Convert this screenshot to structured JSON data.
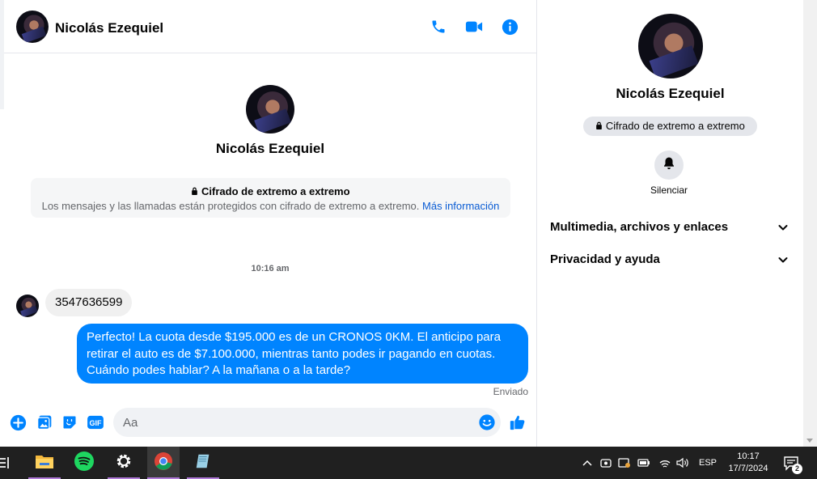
{
  "conversation": {
    "contact_name": "Nicolás Ezequiel"
  },
  "encryption": {
    "title": "Cifrado de extremo a extremo",
    "description": "Los mensajes y las llamadas están protegidos con cifrado de extremo a extremo.",
    "link": "Más información"
  },
  "messages": {
    "timestamp": "10:16 am",
    "incoming_text": "3547636599",
    "outgoing_text": "Perfecto! La cuota desde $195.000 es de un CRONOS 0KM. El anticipo para retirar el auto es de $7.100.000, mientras tanto podes ir pagando en cuotas. Cuándo podes hablar? A la mañana o a la tarde?",
    "status": "Enviado"
  },
  "composer": {
    "placeholder": "Aa",
    "icons": [
      "plus-icon",
      "photo-icon",
      "sticker-icon",
      "gif-icon",
      "emoji-icon",
      "thumbs-up-icon"
    ]
  },
  "info_panel": {
    "name": "Nicolás Ezequiel",
    "badge": "Cifrado de extremo a extremo",
    "mute_label": "Silenciar",
    "sections": [
      "Multimedia, archivos y enlaces",
      "Privacidad y ayuda"
    ]
  },
  "taskbar": {
    "apps": [
      "file-explorer-icon",
      "spotify-icon",
      "settings-icon",
      "chrome-icon",
      "notes-icon"
    ],
    "language": "ESP",
    "time": "10:17",
    "date": "17/7/2024",
    "notification_count": "2"
  },
  "colors": {
    "accent": "#0084ff",
    "link": "#0a5cd4",
    "taskbar": "#202020"
  }
}
